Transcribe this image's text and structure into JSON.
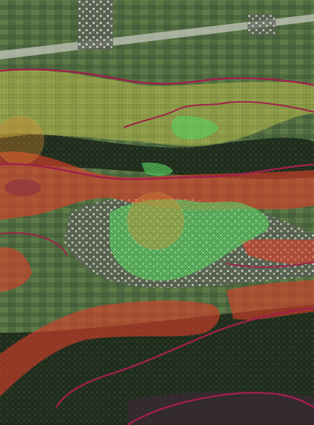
{
  "map": {
    "kind": "aerial-photo-with-hazard-zoning-overlay",
    "legend_visible": false,
    "colors": {
      "yellow_zone": "#c8c84a",
      "red_zone": "#e0402a",
      "green_zone": "#3fbf4a",
      "boundary_line": "#a0204a",
      "orange_point_zone": "#e08a30",
      "lake": "#1e3556"
    },
    "zones": [
      {
        "id": "yellow-slope-band",
        "color": "yellow_zone",
        "label": ""
      },
      {
        "id": "red-band-upper",
        "color": "red_zone",
        "label": ""
      },
      {
        "id": "red-band-middle-right",
        "color": "red_zone",
        "label": ""
      },
      {
        "id": "red-band-lower",
        "color": "red_zone",
        "label": ""
      },
      {
        "id": "green-village-zone",
        "color": "green_zone",
        "label": ""
      },
      {
        "id": "orange-circle-village",
        "color": "orange_point_zone",
        "label": ""
      },
      {
        "id": "orange-circle-left",
        "color": "orange_point_zone",
        "label": ""
      }
    ]
  }
}
